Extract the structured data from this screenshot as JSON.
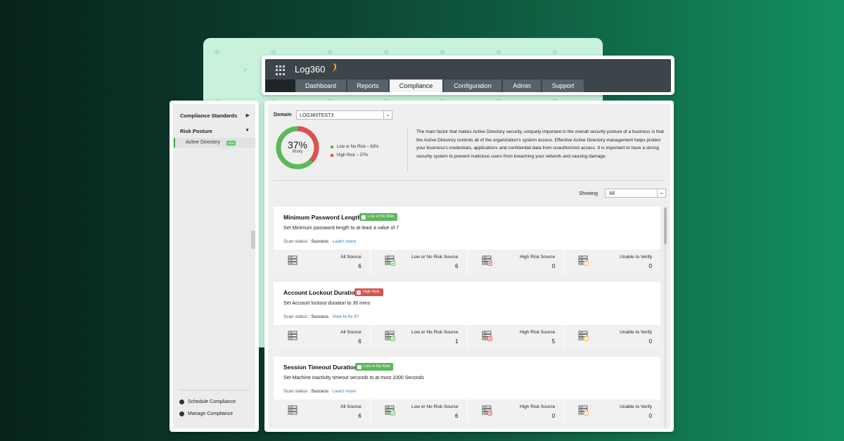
{
  "app": {
    "brand": "Log360"
  },
  "nav": {
    "tabs": [
      {
        "label": "Dashboard",
        "width": 72
      },
      {
        "label": "Reports",
        "width": 58
      },
      {
        "label": "Compliance",
        "width": 75,
        "active": true
      },
      {
        "label": "Configuration",
        "width": 82
      },
      {
        "label": "Admin",
        "width": 54
      },
      {
        "label": "Support",
        "width": 59
      }
    ]
  },
  "sidebar": {
    "compliance_standards": "Compliance Standards",
    "risk_posture": "Risk Posture",
    "active_directory": "Active Directory",
    "new_badge": "NEW",
    "schedule": "Schedule Compliance",
    "manage": "Manage Compliance"
  },
  "domain": {
    "label": "Domain",
    "value": "LOG360TEST3"
  },
  "risk_summary": {
    "percent": "37%",
    "sub": "Risky",
    "risky_fraction": 0.37,
    "low_label": "Low or No Risk – 63%",
    "high_label": "High Risk – 37%",
    "low_color": "#5cb85c",
    "high_color": "#d9534f"
  },
  "description": "The main factor that makes Active Directory security, uniquely important in the overall security posture of a business is that the Active Directory controls all of the organization's system access. Effective Active Directory management helps protect your business's credentials, applications and confidential data from unauthorized access. It is important to have a strong security system to prevent malicious users from breaching your network and causing damage.",
  "filter": {
    "label": "Showing",
    "value": "All"
  },
  "checks": [
    {
      "title": "Minimum Password Length -",
      "risk": "Low or No Risk",
      "risk_level": "low",
      "description": "Set Minimum password length to at least a value of 7",
      "scan_label": "Scan status :",
      "scan_status": "Success",
      "link": "Learn more",
      "stats": [
        {
          "label": "All Source",
          "value": "6",
          "icon": "server-icon"
        },
        {
          "label": "Low or No Risk Source",
          "value": "6",
          "icon": "server-check-icon"
        },
        {
          "label": "High Risk Source",
          "value": "0",
          "icon": "server-error-icon"
        },
        {
          "label": "Unable to Verify",
          "value": "0",
          "icon": "server-warning-icon"
        }
      ]
    },
    {
      "title": "Account Lockout Duration -",
      "risk": "High Risk",
      "risk_level": "high",
      "description": "Set Account lockout duration to 30 mins",
      "scan_label": "Scan status :",
      "scan_status": "Success",
      "link": "How to fix it?",
      "stats": [
        {
          "label": "All Source",
          "value": "6",
          "icon": "server-icon"
        },
        {
          "label": "Low or No Risk Source",
          "value": "1",
          "icon": "server-check-icon"
        },
        {
          "label": "High Risk Source",
          "value": "5",
          "icon": "server-error-icon"
        },
        {
          "label": "Unable to Verify",
          "value": "0",
          "icon": "server-warning-icon"
        }
      ]
    },
    {
      "title": "Session Timeout Duration -",
      "risk": "Low or No Risk",
      "risk_level": "low",
      "description": "Set Machine inactivity timeout seconds to at most 1000 Seconds",
      "scan_label": "Scan status :",
      "scan_status": "Success",
      "link": "Learn more",
      "stats": [
        {
          "label": "All Source",
          "value": "6",
          "icon": "server-icon"
        },
        {
          "label": "Low or No Risk Source",
          "value": "6",
          "icon": "server-check-icon"
        },
        {
          "label": "High Risk Source",
          "value": "0",
          "icon": "server-error-icon"
        },
        {
          "label": "Unable to Verify",
          "value": "0",
          "icon": "server-warning-icon"
        }
      ]
    }
  ]
}
